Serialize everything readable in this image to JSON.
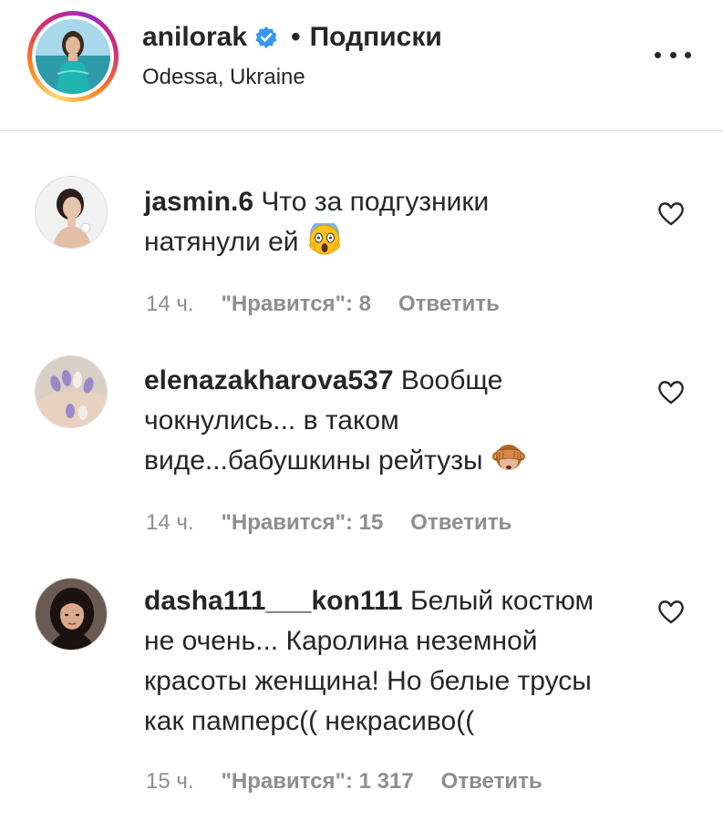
{
  "post_header": {
    "username": "anilorak",
    "separator": "•",
    "follow_status": "Подписки",
    "location": "Odessa, Ukraine",
    "verified_color": "#3897f0"
  },
  "comments": [
    {
      "username": "jasmin.6",
      "text": "Что за подгузники натянули ей",
      "emoji": "face-screaming-in-fear",
      "time": "14 ч.",
      "likes": "\"Нравится\": 8",
      "reply": "Ответить"
    },
    {
      "username": "elenazakharova537",
      "text": "Вообще чокнулись... в таком виде...бабушкины рейтузы",
      "emoji": "see-no-evil-monkey",
      "time": "14 ч.",
      "likes": "\"Нравится\": 15",
      "reply": "Ответить"
    },
    {
      "username": "dasha111___kon111",
      "text": "Белый костюм не очень... Каролина неземной красоты женщина! Но белые трусы как памперс(( некрасиво((",
      "time": "15 ч.",
      "likes": "\"Нравится\": 1 317",
      "reply": "Ответить"
    }
  ]
}
